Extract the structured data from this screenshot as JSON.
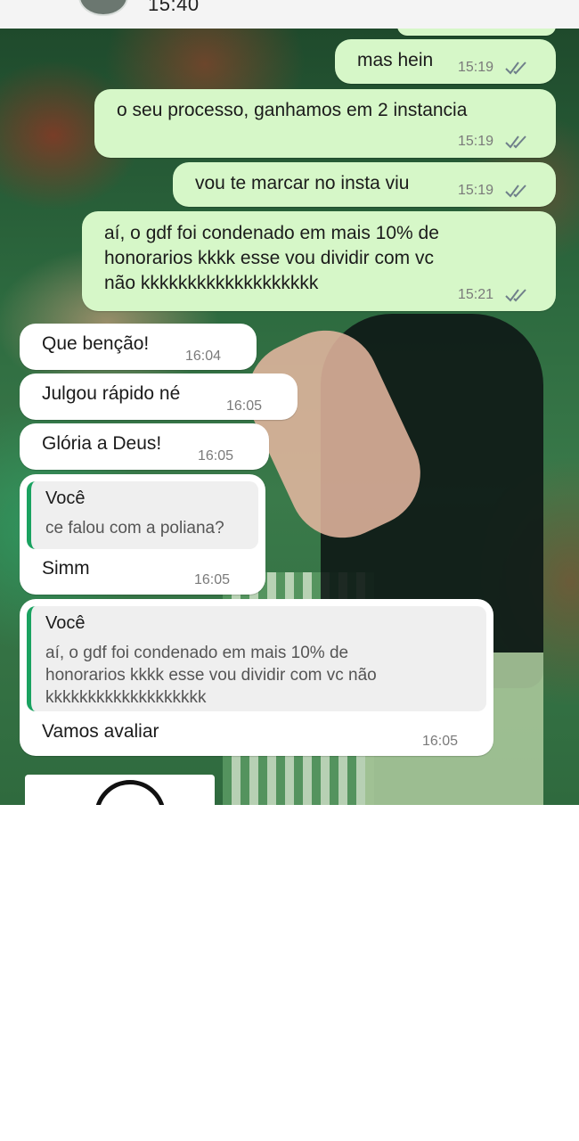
{
  "header": {
    "time": "15:40"
  },
  "messages": [
    {
      "text": "mas hein",
      "time": "15:19",
      "ticks": "double-check-icon"
    },
    {
      "text": "o seu processo, ganhamos em 2 instancia",
      "time": "15:19",
      "ticks": "double-check-icon"
    },
    {
      "text": "vou te marcar no insta viu",
      "time": "15:19",
      "ticks": "double-check-icon"
    },
    {
      "lines": [
        "aí, o gdf foi condenado em mais 10% de",
        "honorarios kkkk esse vou dividir com vc",
        "não kkkkkkkkkkkkkkkkkkk"
      ],
      "time": "15:21",
      "ticks": "double-check-icon"
    },
    {
      "text": "Que benção!",
      "time": "16:04"
    },
    {
      "text": "Julgou rápido né",
      "time": "16:05"
    },
    {
      "text": "Glória a Deus!",
      "time": "16:05"
    },
    {
      "reply_author": "Você",
      "reply_text": "ce falou com a poliana?",
      "text": "Simm",
      "time": "16:05"
    },
    {
      "reply_author": "Você",
      "reply_lines": [
        "aí, o gdf foi condenado em mais 10% de",
        "honorarios kkkk esse vou dividir com vc não",
        "kkkkkkkkkkkkkkkkkkk"
      ],
      "text": "Vamos avaliar",
      "time": "16:05"
    }
  ],
  "colors": {
    "outgoing_bubble": "#d6f7c8",
    "incoming_bubble": "#ffffff",
    "reply_accent": "#1aa260",
    "ticks": "#6f7f8a"
  },
  "icons": {
    "read_receipt": "double-check-icon",
    "avatar": "avatar"
  }
}
